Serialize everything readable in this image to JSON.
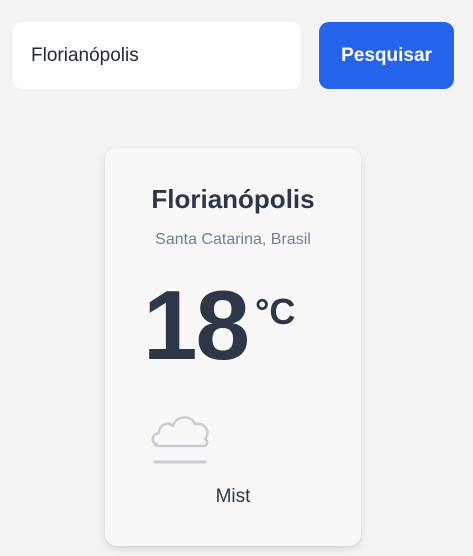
{
  "search": {
    "value": "Florianópolis",
    "button_label": "Pesquisar"
  },
  "weather": {
    "city": "Florianópolis",
    "region": "Santa Catarina, Brasil",
    "temperature": "18",
    "unit": "°C",
    "condition": "Mist",
    "icon": "mist-cloud-icon"
  },
  "colors": {
    "accent": "#2563eb",
    "background": "#f3f3f4",
    "text_dark": "#2d3748",
    "text_muted": "#718096"
  }
}
